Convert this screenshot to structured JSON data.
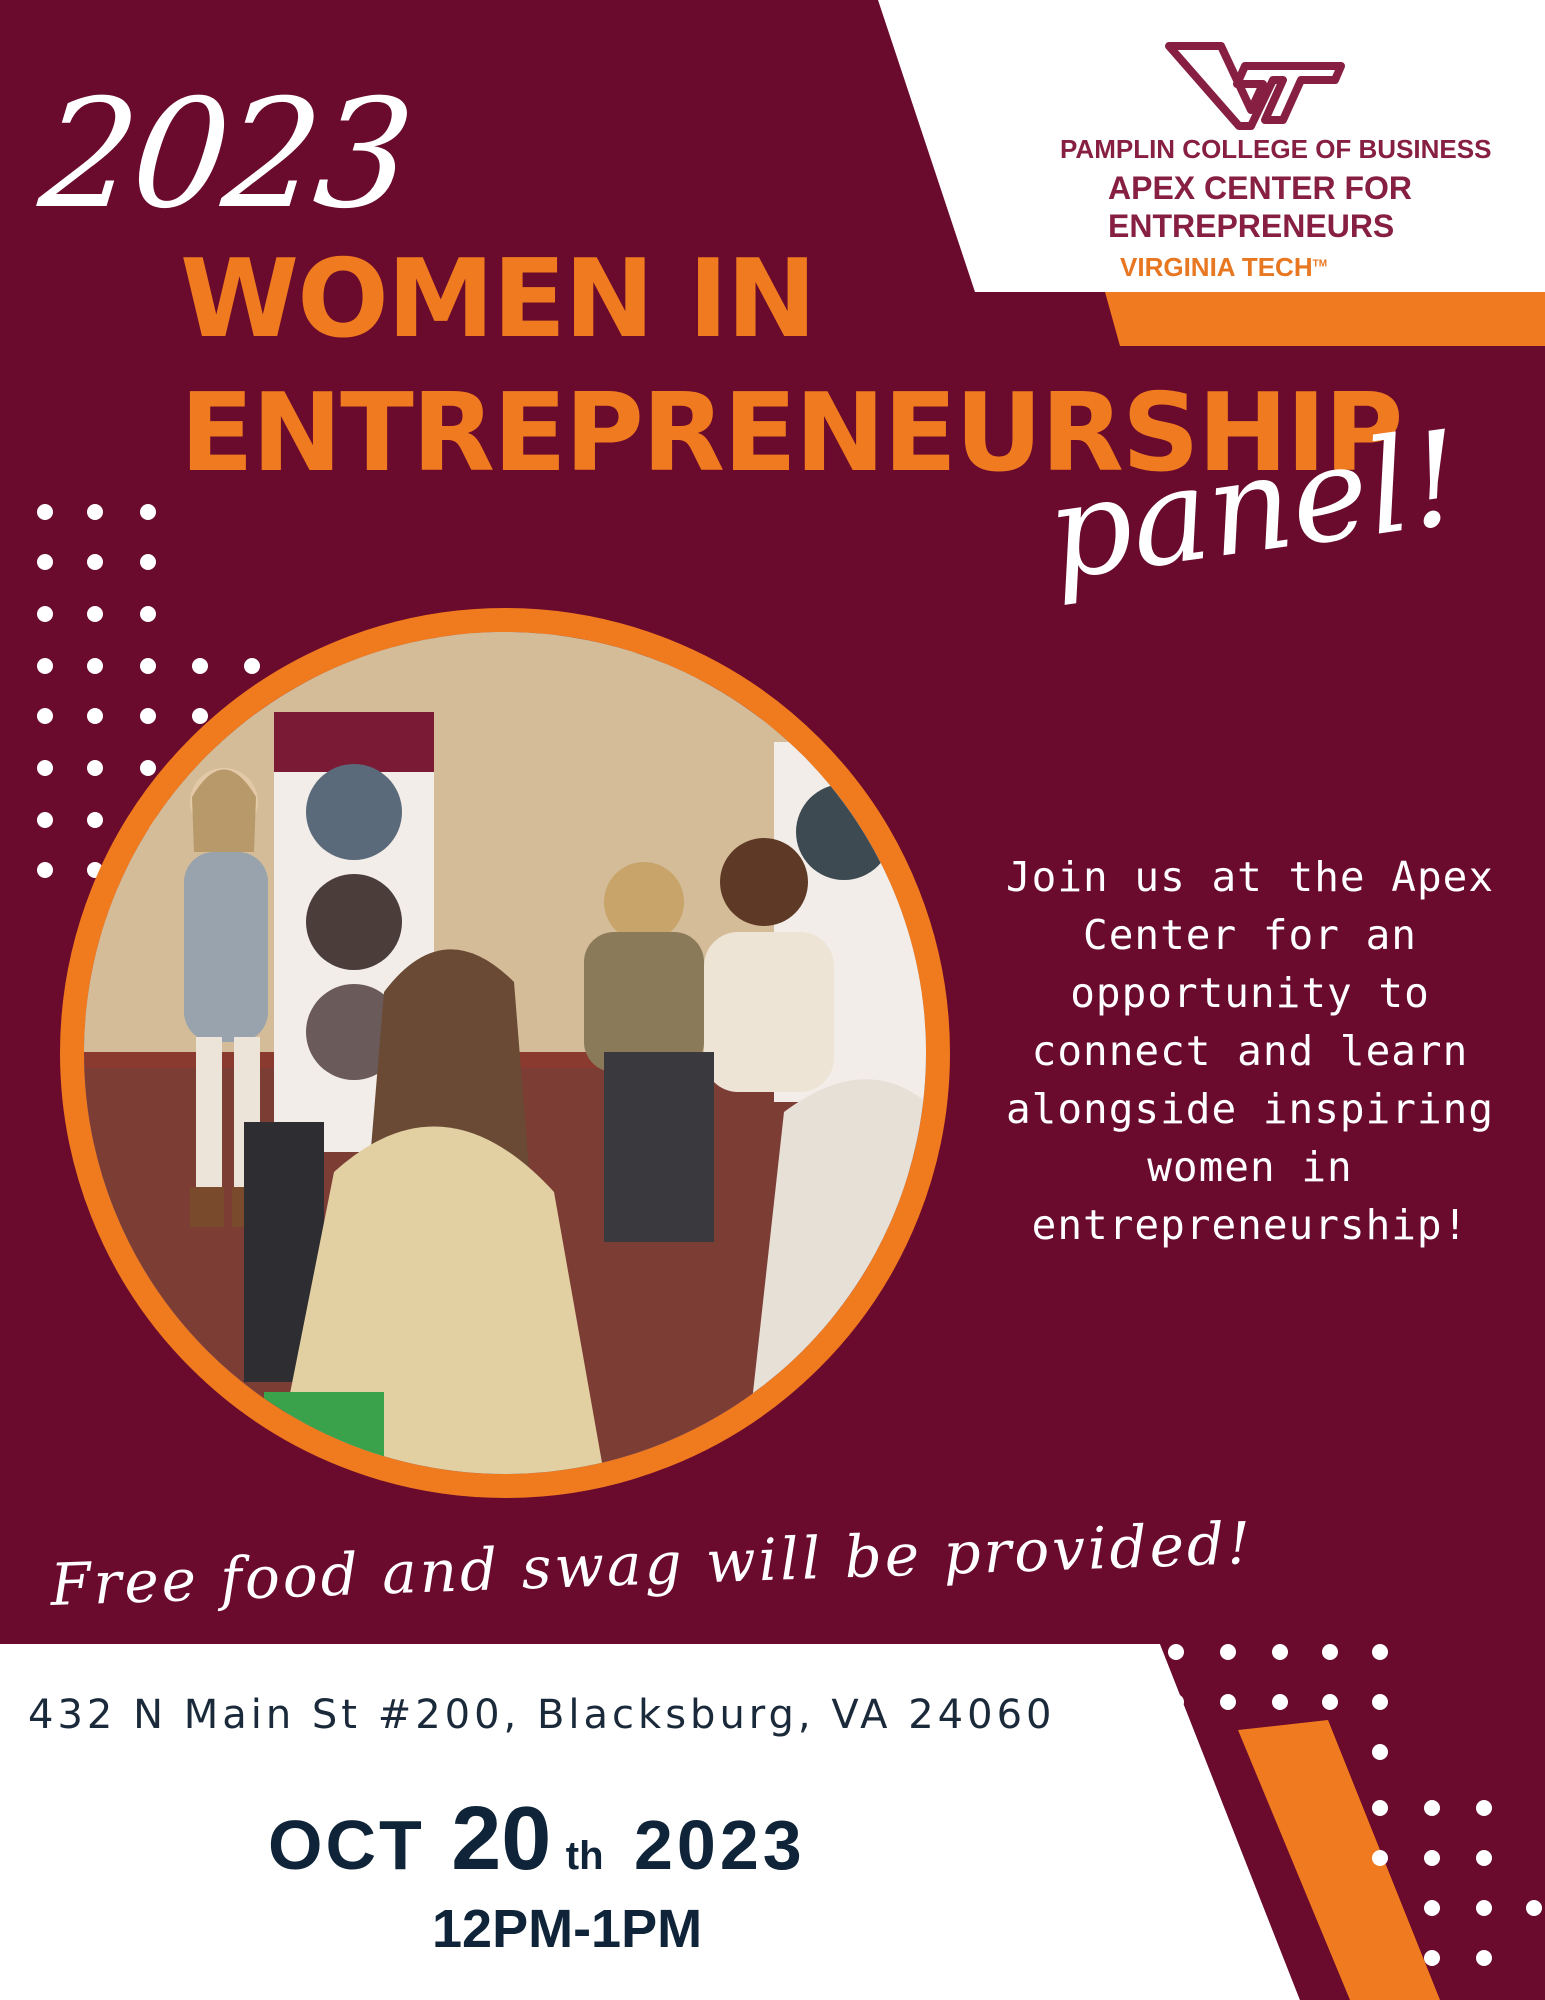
{
  "colors": {
    "maroon": "#6a0a2d",
    "orange": "#ef7a1f",
    "white": "#ffffff",
    "navy": "#0f2438"
  },
  "header": {
    "year": "2023",
    "title_line1": "WOMEN IN",
    "title_line2": "ENTREPRENEURSHIP",
    "title_script": "panel!"
  },
  "logo": {
    "mark": "VT",
    "line1": "PAMPLIN COLLEGE OF BUSINESS",
    "line2": "APEX CENTER FOR",
    "line3": "ENTREPRENEURS",
    "line4": "VIRGINIA TECH",
    "tm": "TM"
  },
  "photo": {
    "description_icon": "event-photo"
  },
  "body": {
    "join_lines": [
      "Join us at the Apex",
      "Center for an",
      "opportunity to",
      "connect and learn",
      "alongside inspiring",
      "women in",
      "entrepreneurship!"
    ],
    "free_note": "Free food and swag will be provided!"
  },
  "event": {
    "address": "432 N Main St #200, Blacksburg, VA 24060",
    "month": "OCT",
    "day": "20",
    "suffix": "th",
    "year": "2023",
    "time": "12PM-1PM"
  }
}
